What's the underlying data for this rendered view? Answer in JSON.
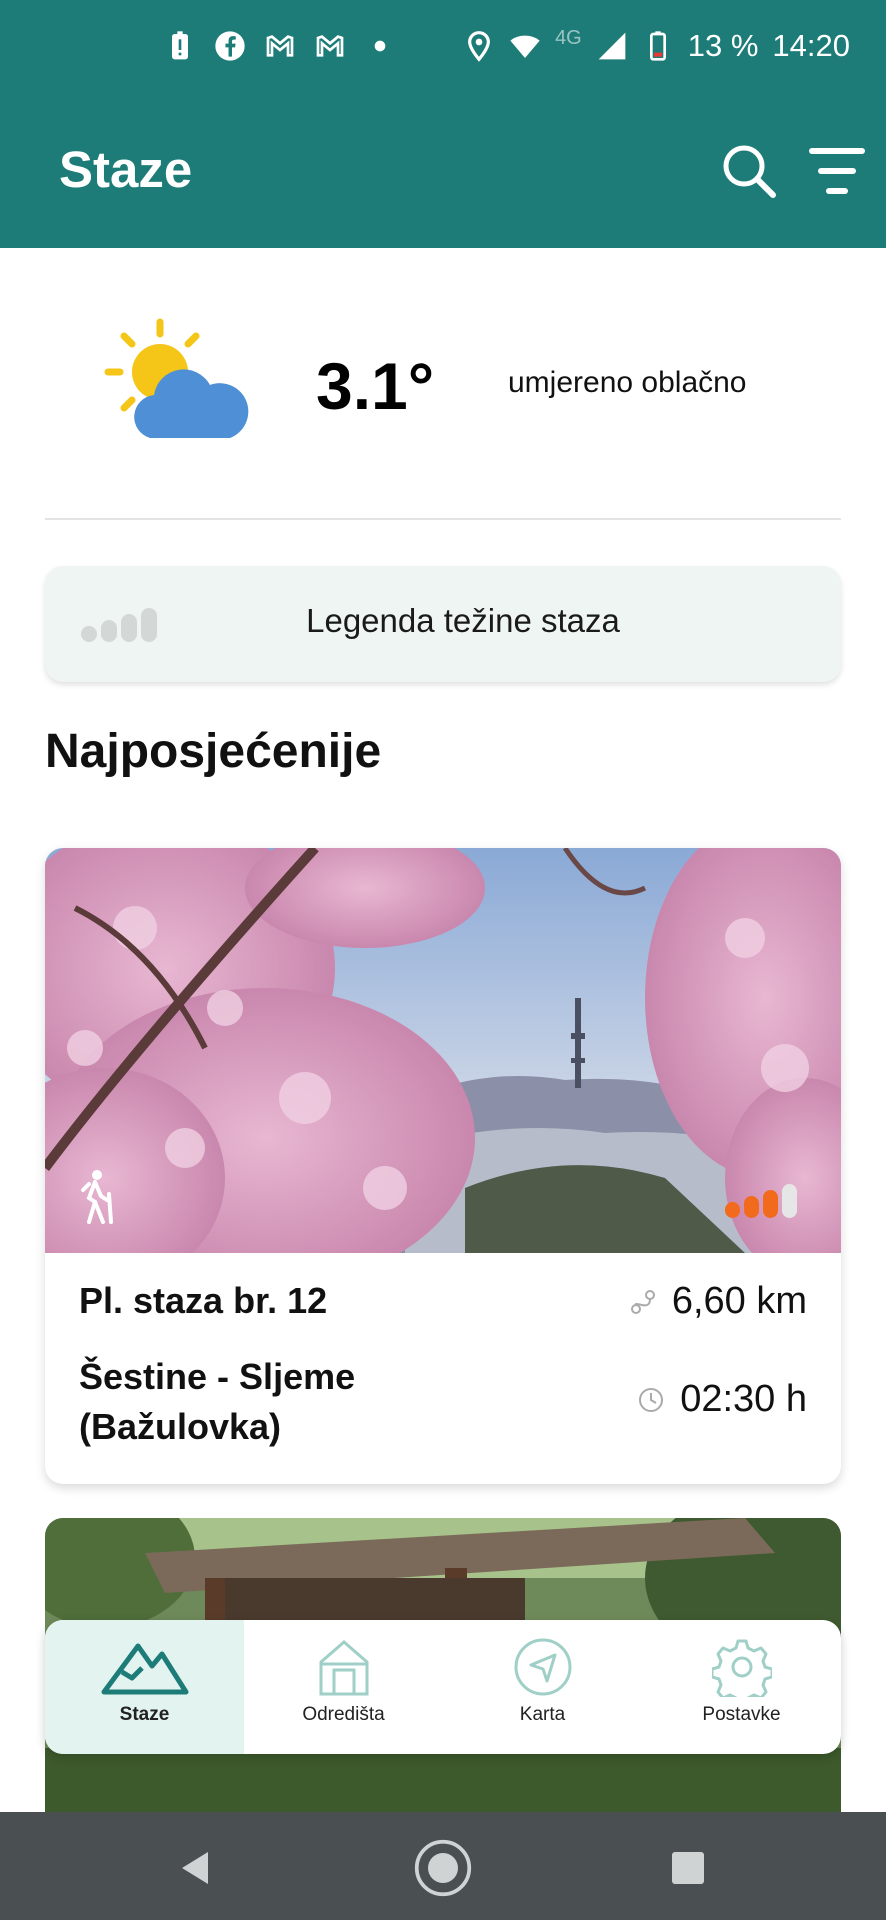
{
  "status_bar": {
    "battery_percent": "13 %",
    "time": "14:20",
    "network": "4G",
    "icons": [
      "battery-alert-icon",
      "facebook-icon",
      "gmail-icon",
      "gmail-icon",
      "dot-icon",
      "location-icon",
      "wifi-icon",
      "signal-icon",
      "battery-icon"
    ]
  },
  "app_bar": {
    "title": "Staze",
    "actions": [
      "search-icon",
      "filter-icon"
    ]
  },
  "weather": {
    "temperature": "3.1°",
    "condition": "umjereno oblačno",
    "icon": "partly-cloudy-icon"
  },
  "legend": {
    "label": "Legenda težine staza"
  },
  "section": {
    "title": "Najposjećenije"
  },
  "trails": [
    {
      "name": "Pl. staza br. 12",
      "route": "Šestine - Sljeme (Bažulovka)",
      "distance": "6,60 km",
      "duration": "02:30 h",
      "difficulty_level": 3,
      "difficulty_max": 4,
      "difficulty_color": "#f26b1d"
    }
  ],
  "bottom_nav": {
    "items": [
      {
        "label": "Staze",
        "icon": "mountain-icon",
        "active": true
      },
      {
        "label": "Odredišta",
        "icon": "house-icon",
        "active": false
      },
      {
        "label": "Karta",
        "icon": "navigation-icon",
        "active": false
      },
      {
        "label": "Postavke",
        "icon": "gear-icon",
        "active": false
      }
    ]
  },
  "colors": {
    "primary": "#1d7c78",
    "active_nav_bg": "#e3f3ef",
    "legend_bg": "#eff5f3",
    "difficulty_active": "#f26b1d"
  }
}
